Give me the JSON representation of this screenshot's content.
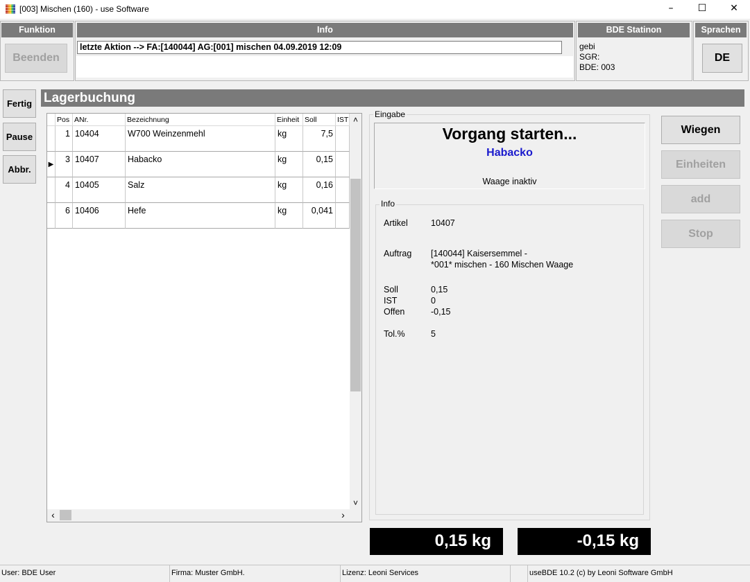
{
  "window": {
    "title": "[003] Mischen (160) - use Software",
    "minimize": "–",
    "maximize": "☐",
    "close": "✕"
  },
  "funktion": {
    "header": "Funktion",
    "beenden": "Beenden"
  },
  "info": {
    "header": "Info",
    "last_action": "letzte Aktion --> FA:[140044] AG:[001] mischen 04.09.2019 12:09"
  },
  "bde_station": {
    "header": "BDE Statinon",
    "line1": "gebi",
    "line2": "SGR:",
    "line3": "BDE: 003"
  },
  "sprachen": {
    "header": "Sprachen",
    "lang": "DE"
  },
  "side": {
    "fertig": "Fertig",
    "pause": "Pause",
    "abbr": "Abbr."
  },
  "lagerbuchung": {
    "title": "Lagerbuchung"
  },
  "grid": {
    "columns": [
      "Pos",
      "ANr.",
      "Bezeichnung",
      "Einheit",
      "Soll",
      "IST"
    ],
    "rows": [
      {
        "pos": "1",
        "anr": "10404",
        "bez": "W700 Weinzenmehl",
        "einheit": "kg",
        "soll": "7,5",
        "ist": ""
      },
      {
        "pos": "3",
        "anr": "10407",
        "bez": "Habacko",
        "einheit": "kg",
        "soll": "0,15",
        "ist": ""
      },
      {
        "pos": "4",
        "anr": "10405",
        "bez": "Salz",
        "einheit": "kg",
        "soll": "0,16",
        "ist": ""
      },
      {
        "pos": "6",
        "anr": "10406",
        "bez": "Hefe",
        "einheit": "kg",
        "soll": "0,041",
        "ist": ""
      }
    ],
    "current_row_marker": "▶",
    "scroll_up": "˄",
    "scroll_down": "˅",
    "scroll_left": "‹",
    "scroll_right": "›"
  },
  "eingabe": {
    "label": "Eingabe",
    "headline": "Vorgang starten...",
    "article": "Habacko",
    "status": "Waage inaktiv"
  },
  "info_detail": {
    "label": "Info",
    "artikel_label": "Artikel",
    "artikel_value": "10407",
    "auftrag_label": "Auftrag",
    "auftrag_line1": "[140044] Kaisersemmel -",
    "auftrag_line2": "*001* mischen - 160 Mischen Waage",
    "soll_label": "Soll",
    "soll_value": "0,15",
    "ist_label": "IST",
    "ist_value": "0",
    "offen_label": "Offen",
    "offen_value": "-0,15",
    "tol_label": "Tol.%",
    "tol_value": "5"
  },
  "actions": {
    "wiegen": "Wiegen",
    "einheiten": "Einheiten",
    "add": "add",
    "stop": "Stop"
  },
  "display": {
    "ist_kg": "0,15 kg",
    "offen_kg": "-0,15 kg"
  },
  "statusbar": {
    "user": "User: BDE User",
    "firma": "Firma: Muster GmbH.",
    "lizenz": "Lizenz: Leoni Services",
    "empty": "",
    "version": "useBDE 10.2 (c) by Leoni Software GmbH"
  },
  "colors": {
    "header_gray": "#7a7a7a",
    "accent_blue": "#1a1acd",
    "display_bg": "#000000"
  }
}
